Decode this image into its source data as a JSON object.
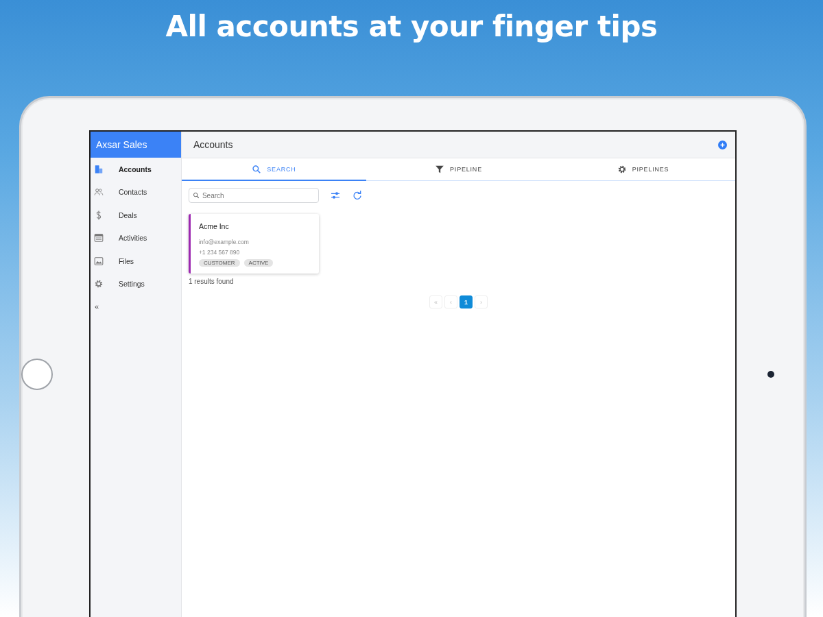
{
  "headline": "All accounts at your finger tips",
  "app": {
    "brand": "Axsar Sales",
    "page_title": "Accounts",
    "sidebar": {
      "items": [
        {
          "label": "Accounts",
          "selected": true
        },
        {
          "label": "Contacts",
          "selected": false
        },
        {
          "label": "Deals",
          "selected": false
        },
        {
          "label": "Activities",
          "selected": false
        },
        {
          "label": "Files",
          "selected": false
        },
        {
          "label": "Settings",
          "selected": false
        }
      ],
      "collapse": "«"
    },
    "tabs": [
      {
        "label": "SEARCH",
        "selected": true
      },
      {
        "label": "PIPELINE",
        "selected": false
      },
      {
        "label": "PIPELINES",
        "selected": false
      }
    ],
    "search": {
      "placeholder": "Search"
    },
    "cards": [
      {
        "name": "Acme Inc",
        "email": "info@example.com",
        "phone": "+1 234 567 890",
        "color": "#9c27b0",
        "tags": [
          "CUSTOMER",
          "ACTIVE"
        ]
      }
    ],
    "results": "1 results found",
    "pagination": [
      {
        "label": "«",
        "selected": false
      },
      {
        "label": "‹",
        "selected": false
      },
      {
        "label": "1",
        "selected": true
      },
      {
        "label": "›",
        "selected": false
      }
    ]
  }
}
